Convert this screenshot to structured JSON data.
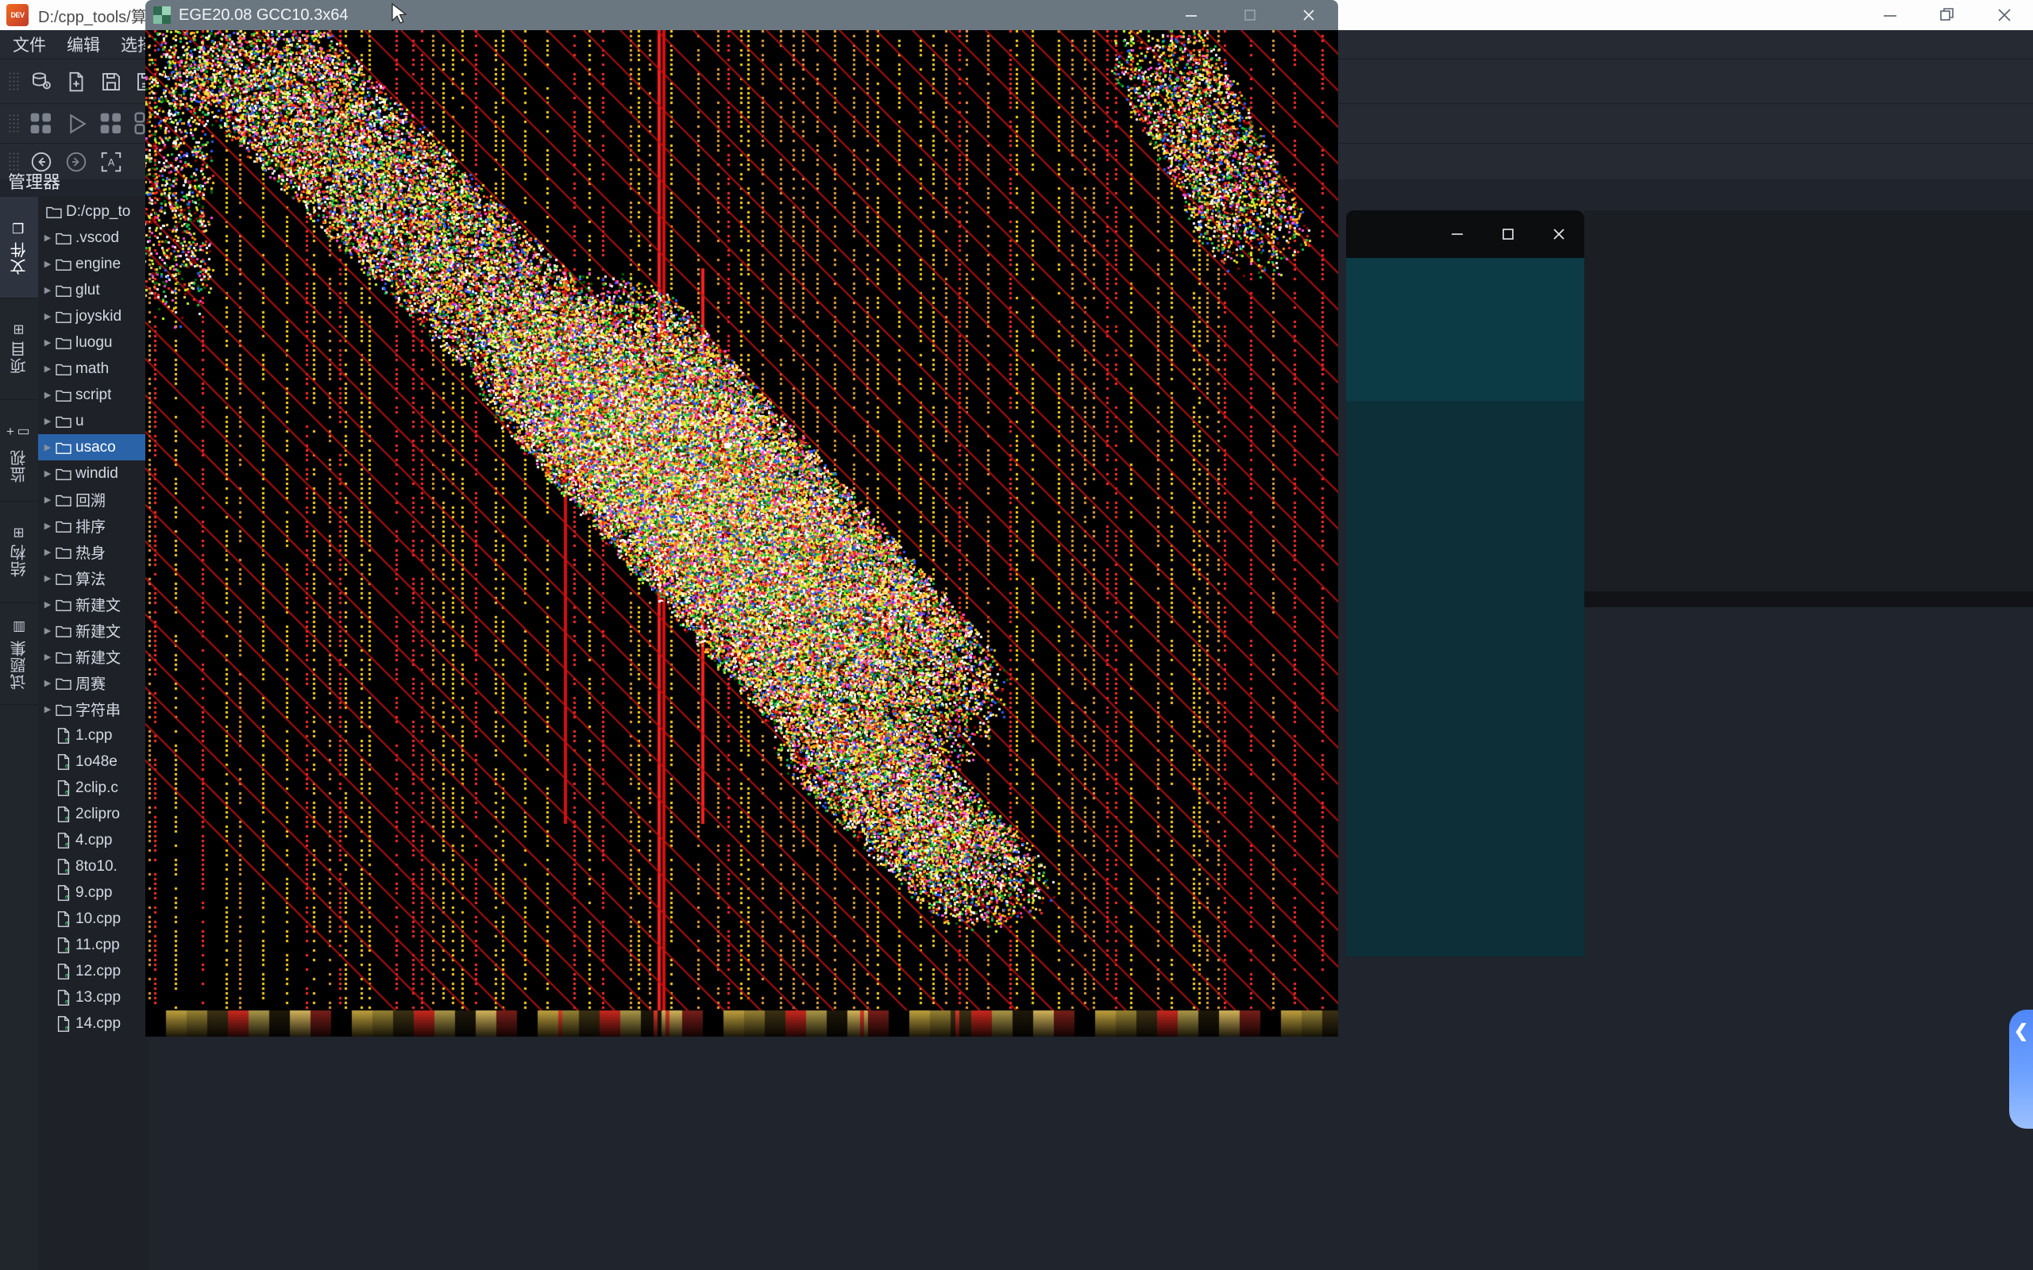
{
  "ide": {
    "path_title": "D:/cpp_tools/算法/",
    "logo_text": "DEV",
    "menu": [
      "文件",
      "编辑",
      "选择"
    ],
    "window_controls": [
      {
        "name": "minimize",
        "glyph": "minimize-icon"
      },
      {
        "name": "restore",
        "glyph": "restore-icon"
      },
      {
        "name": "close",
        "glyph": "close-icon"
      }
    ],
    "toolbar_row1": [
      "database-icon",
      "new-file-icon",
      "save-icon",
      "save-all-icon"
    ],
    "toolbar_row2": [
      "compile-icon",
      "run-icon",
      "compile-run-icon",
      "rebuild-icon",
      "settings-icon"
    ],
    "toolbar_row3": [
      "back-icon",
      "forward-icon",
      "select-all-icon"
    ],
    "explorer_title": "管理器"
  },
  "activity_tabs": [
    {
      "label": "文件",
      "icon": "files-icon",
      "selected": true
    },
    {
      "label": "项目",
      "icon": "project-icon",
      "selected": false
    },
    {
      "label": "监视",
      "icon": "watch-icon",
      "selected": false
    },
    {
      "label": "结构",
      "icon": "structure-icon",
      "selected": false
    },
    {
      "label": "试题集",
      "icon": "problemset-icon",
      "selected": false
    }
  ],
  "tree": {
    "root": "D:/cpp_to",
    "items": [
      {
        "name": ".vscod",
        "type": "folder",
        "selected": false
      },
      {
        "name": "engine",
        "type": "folder",
        "selected": false
      },
      {
        "name": "glut",
        "type": "folder",
        "selected": false
      },
      {
        "name": "joyskid",
        "type": "folder",
        "selected": false
      },
      {
        "name": "luogu",
        "type": "folder",
        "selected": false
      },
      {
        "name": "math",
        "type": "folder",
        "selected": false
      },
      {
        "name": "script",
        "type": "folder",
        "selected": false
      },
      {
        "name": "u",
        "type": "folder",
        "selected": false
      },
      {
        "name": "usaco",
        "type": "folder",
        "selected": true
      },
      {
        "name": "windid",
        "type": "folder",
        "selected": false
      },
      {
        "name": "回溯",
        "type": "folder",
        "selected": false
      },
      {
        "name": "排序",
        "type": "folder",
        "selected": false
      },
      {
        "name": "热身",
        "type": "folder",
        "selected": false
      },
      {
        "name": "算法",
        "type": "folder",
        "selected": false
      },
      {
        "name": "新建文",
        "type": "folder",
        "selected": false
      },
      {
        "name": "新建文",
        "type": "folder",
        "selected": false
      },
      {
        "name": "新建文",
        "type": "folder",
        "selected": false
      },
      {
        "name": "周赛",
        "type": "folder",
        "selected": false
      },
      {
        "name": "字符串",
        "type": "folder",
        "selected": false
      },
      {
        "name": "1.cpp",
        "type": "cpp",
        "selected": false
      },
      {
        "name": "1o48e",
        "type": "cpp",
        "selected": false
      },
      {
        "name": "2clip.c",
        "type": "cpp",
        "selected": false
      },
      {
        "name": "2clipro",
        "type": "cpp",
        "selected": false
      },
      {
        "name": "4.cpp",
        "type": "cpp",
        "selected": false
      },
      {
        "name": "8to10.",
        "type": "cpp",
        "selected": false
      },
      {
        "name": "9.cpp",
        "type": "cpp",
        "selected": false
      },
      {
        "name": "10.cpp",
        "type": "cpp",
        "selected": false
      },
      {
        "name": "11.cpp",
        "type": "cpp",
        "selected": false
      },
      {
        "name": "12.cpp",
        "type": "cpp",
        "selected": false
      },
      {
        "name": "13.cpp",
        "type": "cpp",
        "selected": false
      },
      {
        "name": "14.cpp",
        "type": "cpp",
        "selected": false
      }
    ]
  },
  "ege_window": {
    "title": "EGE20.08 GCC10.3x64",
    "icon": "ege-app-icon",
    "controls": [
      {
        "name": "minimize",
        "glyph": "minimize-icon",
        "enabled": true
      },
      {
        "name": "maximize",
        "glyph": "maximize-icon",
        "enabled": false
      },
      {
        "name": "close",
        "glyph": "close-icon",
        "enabled": true
      }
    ],
    "canvas_description": "colored noise fractal render on black background"
  },
  "background_window": {
    "controls": [
      {
        "name": "minimize",
        "glyph": "minimize-icon"
      },
      {
        "name": "maximize",
        "glyph": "maximize-icon"
      },
      {
        "name": "close",
        "glyph": "close-icon"
      }
    ]
  },
  "edge_tab": {
    "icon": "chevron-left-icon",
    "glyph": "❮"
  },
  "colors": {
    "accent_blue": "#2a63a8",
    "edge_tab_blue": "#6ea2ff",
    "title_gray": "#6b7780",
    "panel_dark": "#1e2228",
    "teal": "#0d3b45"
  },
  "cursor": {
    "icon": "mouse-pointer-icon"
  }
}
